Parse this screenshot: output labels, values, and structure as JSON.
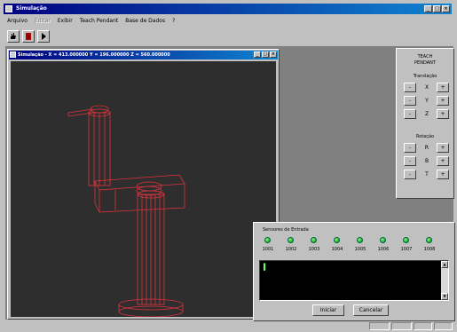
{
  "app": {
    "title": "Simulação"
  },
  "menu": [
    "Arquivo",
    "Editar",
    "Exibir",
    "Teach Pendant",
    "Base de Dados",
    "?"
  ],
  "menu_disabled": [
    false,
    true,
    false,
    false,
    false,
    false
  ],
  "toolbar": {
    "icons": [
      "hand-icon",
      "stop-icon",
      "play-icon"
    ]
  },
  "sim_window": {
    "title": "Simulação - X = 413.000000 Y = 196.000000 Z = 560.000000"
  },
  "teach": {
    "title_line1": "TEACH",
    "title_line2": "PENDANT",
    "translation_label": "Translação",
    "rotation_label": "Rotação",
    "minus": "-",
    "plus": "+",
    "trans_axes": [
      "X",
      "Y",
      "Z"
    ],
    "rot_axes": [
      "R",
      "B",
      "T"
    ]
  },
  "io": {
    "label": "Sensores de Entrada",
    "sensors": [
      "1001",
      "1002",
      "1003",
      "1004",
      "1005",
      "1006",
      "1007",
      "1008"
    ],
    "console_cursor": "▌",
    "start_button": "Iniciar",
    "cancel_button": "Cancelar"
  },
  "status_cells": [
    "",
    "",
    "",
    ""
  ],
  "colors": {
    "wireframe": "#e0323c",
    "titlebar": "#000080",
    "led": "#1ec81e",
    "viewport": "#2e2e2e"
  }
}
